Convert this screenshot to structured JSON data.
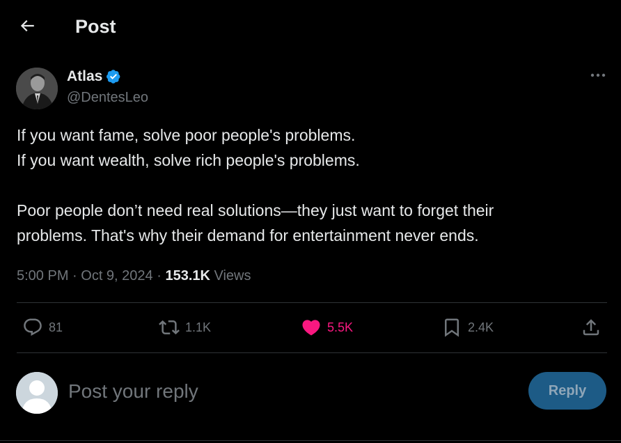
{
  "header": {
    "title": "Post"
  },
  "author": {
    "name": "Atlas",
    "handle": "@DentesLeo",
    "verified": true
  },
  "tweet": {
    "lines_paragraph_1": [
      "If you want fame, solve poor people's problems.",
      "If you want wealth, solve rich people's problems."
    ],
    "lines_paragraph_2": [
      "Poor people don’t need real solutions—they just want to forget their",
      "problems. That's why their demand for entertainment never ends."
    ],
    "time": "5:00 PM",
    "date": "Oct 9, 2024",
    "separator": " · ",
    "views_count": "153.1K",
    "views_label": " Views"
  },
  "actions": {
    "replies": "81",
    "reposts": "1.1K",
    "likes": "5.5K",
    "bookmarks": "2.4K"
  },
  "reply": {
    "placeholder": "Post your reply",
    "button_label": "Reply"
  },
  "colors": {
    "background": "#000000",
    "text": "#e7e9ea",
    "muted": "#71767b",
    "like": "#f91880",
    "verified": "#1d9bf0",
    "reply_button": "#1d5b86",
    "divider": "#2f3336"
  }
}
